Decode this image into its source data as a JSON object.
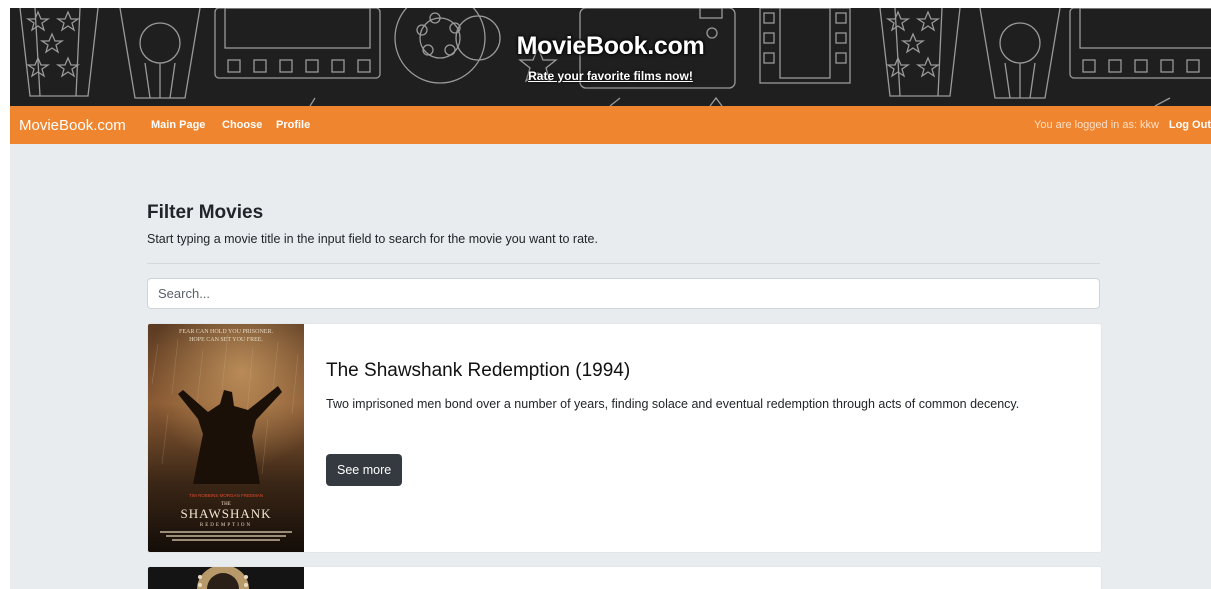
{
  "banner": {
    "title": "MovieBook.com",
    "subtitle": "Rate your favorite films now!"
  },
  "navbar": {
    "brand": "MovieBook.com",
    "links": [
      "Main Page",
      "Choose",
      "Profile"
    ],
    "status": "You are logged in as: kkw",
    "logout": "Log Out",
    "color": "#f0852f"
  },
  "main": {
    "heading": "Filter Movies",
    "instructions": "Start typing a movie title in the input field to search for the movie you want to rate.",
    "search": {
      "placeholder": "Search...",
      "value": ""
    }
  },
  "movies": [
    {
      "title": "The Shawshank Redemption (1994)",
      "description": "Two imprisoned men bond over a number of years, finding solace and eventual redemption through acts of common decency.",
      "button": "See more",
      "poster": {
        "tagline_1": "FEAR CAN HOLD YOU PRISONER.",
        "tagline_2": "HOPE CAN SET YOU FREE.",
        "stars": "TIM ROBBINS   MORGAN FREEMAN",
        "the": "THE",
        "name": "SHAWSHANK",
        "sub": "REDEMPTION"
      }
    }
  ],
  "colors": {
    "banner_bg": "#1f1f1f",
    "page_bg": "#e9ecef",
    "button_bg": "#343a40"
  }
}
